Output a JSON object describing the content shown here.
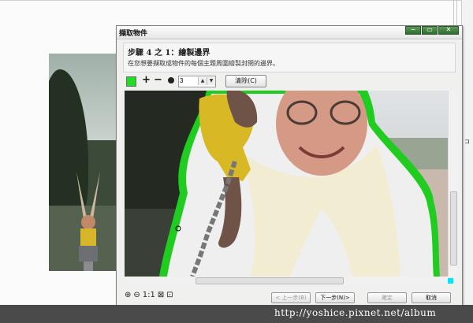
{
  "watermark": "http://yoshice.pixnet.net/album",
  "dialog": {
    "title": "擷取物件",
    "window_buttons": {
      "minimize": "−",
      "restore": "▭",
      "close": "✕"
    },
    "step": "步驟 4 之 1：繪製邊界",
    "description": "在您想要擷取成物件的每個主題周圍繪製封閉的邊界。",
    "toolbar": {
      "brush_color": "#22dd22",
      "zoom_in_glyph": "+",
      "zoom_out_glyph": "−",
      "brush_size_value": "3",
      "clear_label": "清除(C)"
    },
    "zoom_controls": {
      "one_to_one": "1:1"
    },
    "buttons": {
      "back": "< 上一步(B)",
      "next": "下一步(N)>",
      "ok": "確定",
      "cancel": "取消"
    }
  }
}
